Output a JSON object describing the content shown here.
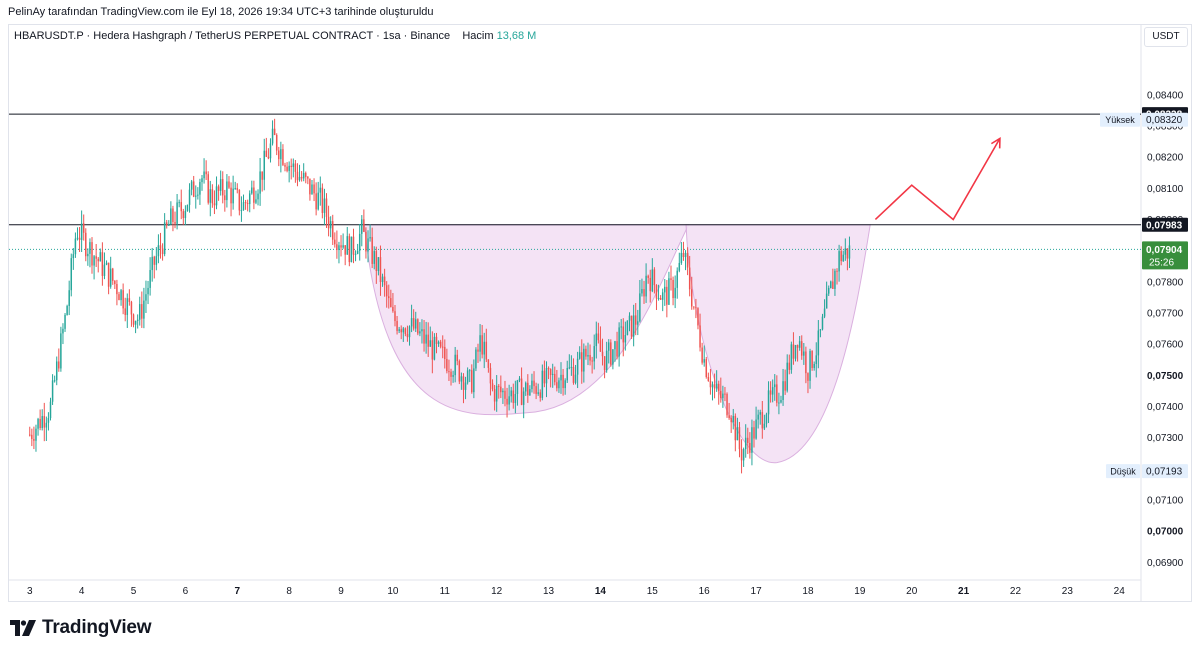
{
  "attribution": "PelinAy tarafından TradingView.com ile Eyl 18, 2026 19:34 UTC+3 tarihinde oluşturuldu",
  "symbol": {
    "ticker": "HBARUSDT.P · Hedera Hashgraph / TetherUS PERPETUAL CONTRACT · 1sa · Binance",
    "volume_label": "Hacim",
    "volume_value": "13,68 M"
  },
  "currency": "USDT",
  "brand": "TradingView",
  "colors": {
    "up": "#26a69a",
    "down": "#ef5350",
    "pattern_fill": "#f3e1f5",
    "pattern_stroke": "#d7a8dc",
    "projection": "#f23645",
    "current_price_bg": "#388e3c",
    "level_label_bg": "#131722"
  },
  "chart_data": {
    "type": "candlestick",
    "ylim": [
      0.0685,
      0.0855
    ],
    "xlim": [
      2.6,
      24.4
    ],
    "y_ticks": [
      "0,08400",
      "0,08300",
      "0,08200",
      "0,08100",
      "0,08000",
      "0,07900",
      "0,07800",
      "0,07700",
      "0,07600",
      "0,07500",
      "0,07400",
      "0,07300",
      "0,07200",
      "0,07100",
      "0,07000",
      "0,06900"
    ],
    "y_tick_values": [
      0.084,
      0.083,
      0.082,
      0.081,
      0.08,
      0.079,
      0.078,
      0.077,
      0.076,
      0.075,
      0.074,
      0.073,
      0.072,
      0.071,
      0.07,
      0.069
    ],
    "bold_ticks": [
      "0,07500",
      "0,07000"
    ],
    "x_ticks": [
      "3",
      "4",
      "5",
      "6",
      "7",
      "8",
      "9",
      "10",
      "11",
      "12",
      "13",
      "14",
      "15",
      "16",
      "17",
      "18",
      "19",
      "20",
      "21",
      "22",
      "23",
      "24"
    ],
    "x_tick_values": [
      3,
      4,
      5,
      6,
      7,
      8,
      9,
      10,
      11,
      12,
      13,
      14,
      15,
      16,
      17,
      18,
      19,
      20,
      21,
      22,
      23,
      24
    ],
    "bold_x_ticks": [
      "7",
      "14",
      "21"
    ],
    "horizontal_levels": [
      {
        "value": 0.08338,
        "label": "0,08338"
      },
      {
        "value": 0.07983,
        "label": "0,07983"
      }
    ],
    "high": {
      "label": "Yüksek",
      "value": "0,08320",
      "y": 0.0832
    },
    "low": {
      "label": "Düşük",
      "value": "0,07193",
      "y": 0.07193
    },
    "current_price": {
      "value": "0,07904",
      "y": 0.07904,
      "countdown": "25:26"
    },
    "price_path": [
      [
        3.0,
        0.0731
      ],
      [
        3.4,
        0.074
      ],
      [
        3.7,
        0.077
      ],
      [
        3.9,
        0.0797
      ],
      [
        4.1,
        0.0792
      ],
      [
        4.4,
        0.0785
      ],
      [
        4.7,
        0.0778
      ],
      [
        4.9,
        0.0772
      ],
      [
        5.1,
        0.0768
      ],
      [
        5.4,
        0.0786
      ],
      [
        5.7,
        0.0799
      ],
      [
        6.0,
        0.0805
      ],
      [
        6.3,
        0.0814
      ],
      [
        6.5,
        0.0807
      ],
      [
        6.8,
        0.081
      ],
      [
        7.1,
        0.0804
      ],
      [
        7.4,
        0.0812
      ],
      [
        7.7,
        0.0826
      ],
      [
        8.0,
        0.0818
      ],
      [
        8.3,
        0.0812
      ],
      [
        8.6,
        0.0806
      ],
      [
        8.9,
        0.0795
      ],
      [
        9.2,
        0.079
      ],
      [
        9.4,
        0.0796
      ],
      [
        9.7,
        0.0785
      ],
      [
        10.0,
        0.0768
      ],
      [
        10.4,
        0.0765
      ],
      [
        10.8,
        0.0758
      ],
      [
        11.2,
        0.0753
      ],
      [
        11.5,
        0.0747
      ],
      [
        11.7,
        0.0762
      ],
      [
        11.9,
        0.0745
      ],
      [
        12.3,
        0.0744
      ],
      [
        12.7,
        0.0746
      ],
      [
        13.1,
        0.0749
      ],
      [
        13.5,
        0.0752
      ],
      [
        13.9,
        0.076
      ],
      [
        14.1,
        0.0755
      ],
      [
        14.4,
        0.0762
      ],
      [
        14.7,
        0.0768
      ],
      [
        14.9,
        0.0783
      ],
      [
        15.2,
        0.0775
      ],
      [
        15.4,
        0.0778
      ],
      [
        15.6,
        0.0789
      ],
      [
        15.8,
        0.0772
      ],
      [
        16.0,
        0.0755
      ],
      [
        16.2,
        0.0745
      ],
      [
        16.5,
        0.074
      ],
      [
        16.7,
        0.0725
      ],
      [
        16.9,
        0.073
      ],
      [
        17.2,
        0.074
      ],
      [
        17.5,
        0.0746
      ],
      [
        17.8,
        0.0763
      ],
      [
        18.0,
        0.0752
      ],
      [
        18.2,
        0.076
      ],
      [
        18.4,
        0.0775
      ],
      [
        18.6,
        0.0788
      ],
      [
        18.8,
        0.079
      ]
    ],
    "cup_region": {
      "x_start": 9.45,
      "x_end": 15.7,
      "rim": 0.07983,
      "bottom": 0.0738
    },
    "handle_region": {
      "x_start": 15.65,
      "x_end": 19.2,
      "rim": 0.07983,
      "bottom": 0.0722
    },
    "projection_path": [
      [
        19.3,
        0.08
      ],
      [
        20.0,
        0.0811
      ],
      [
        20.8,
        0.08
      ],
      [
        21.7,
        0.0826
      ]
    ]
  }
}
